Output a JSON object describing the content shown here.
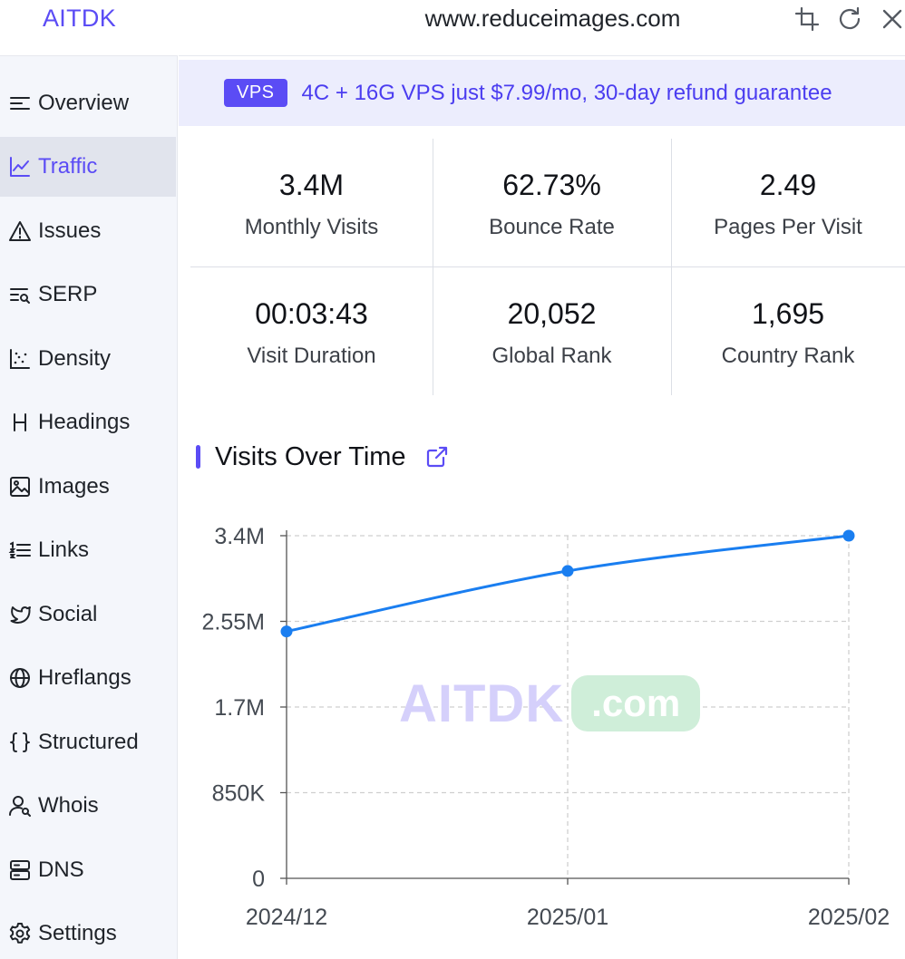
{
  "app": {
    "brand": "AITDK"
  },
  "topbar": {
    "url": "www.reduceimages.com",
    "icons": [
      "crop-icon",
      "refresh-icon",
      "close-icon"
    ]
  },
  "sidebar": {
    "items": [
      {
        "label": "Overview",
        "icon": "overview-icon",
        "active": false
      },
      {
        "label": "Traffic",
        "icon": "traffic-chart-icon",
        "active": true
      },
      {
        "label": "Issues",
        "icon": "warning-icon",
        "active": false
      },
      {
        "label": "SERP",
        "icon": "serp-search-icon",
        "active": false
      },
      {
        "label": "Density",
        "icon": "density-scatter-icon",
        "active": false
      },
      {
        "label": "Headings",
        "icon": "heading-h-icon",
        "active": false
      },
      {
        "label": "Images",
        "icon": "image-icon",
        "active": false
      },
      {
        "label": "Links",
        "icon": "list-links-icon",
        "active": false
      },
      {
        "label": "Social",
        "icon": "twitter-bird-icon",
        "active": false
      },
      {
        "label": "Hreflangs",
        "icon": "globe-icon",
        "active": false
      },
      {
        "label": "Structured",
        "icon": "braces-icon",
        "active": false
      },
      {
        "label": "Whois",
        "icon": "user-search-icon",
        "active": false
      },
      {
        "label": "DNS",
        "icon": "server-icon",
        "active": false
      },
      {
        "label": "Settings",
        "icon": "gear-icon",
        "active": false
      }
    ]
  },
  "banner": {
    "badge": "VPS",
    "text": "4C + 16G VPS just $7.99/mo, 30-day refund guarantee"
  },
  "stats": [
    {
      "value": "3.4M",
      "label": "Monthly Visits"
    },
    {
      "value": "62.73%",
      "label": "Bounce Rate"
    },
    {
      "value": "2.49",
      "label": "Pages Per Visit"
    },
    {
      "value": "00:03:43",
      "label": "Visit Duration"
    },
    {
      "value": "20,052",
      "label": "Global Rank"
    },
    {
      "value": "1,695",
      "label": "Country Rank"
    }
  ],
  "chart": {
    "title": "Visits Over Time",
    "watermark": "AITDK",
    "watermark_suffix": ".com"
  },
  "colors": {
    "accent": "#5b4cf5",
    "line": "#1a7ef0",
    "grid": "#cfcfcf"
  },
  "chart_data": {
    "type": "line",
    "title": "Visits Over Time",
    "categories": [
      "2024/12",
      "2025/01",
      "2025/02"
    ],
    "series": [
      {
        "values": [
          2450000,
          3050000,
          3400000
        ]
      }
    ],
    "ylim": [
      0,
      3400000
    ],
    "yticks": [
      0,
      850000,
      1700000,
      2550000,
      3400000
    ],
    "ytick_labels": [
      "0",
      "850K",
      "1.7M",
      "2.55M",
      "3.4M"
    ],
    "grid": true
  }
}
